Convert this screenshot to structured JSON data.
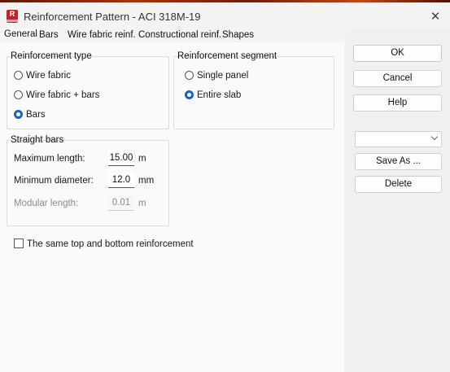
{
  "window": {
    "title": "Reinforcement Pattern - ACI 318M-19",
    "icon_name": "robot-app-icon",
    "icon_letter": "R",
    "close_glyph": "✕"
  },
  "tabs": [
    {
      "label": "General",
      "active": true
    },
    {
      "label": "Bars",
      "active": false
    },
    {
      "label": "Wire fabric reinf.",
      "active": false
    },
    {
      "label": "Constructional reinf.",
      "active": false
    },
    {
      "label": "Shapes",
      "active": false
    }
  ],
  "reinforcement_type": {
    "label": "Reinforcement type",
    "options": [
      {
        "label": "Wire fabric",
        "selected": false
      },
      {
        "label": "Wire fabric + bars",
        "selected": false
      },
      {
        "label": "Bars",
        "selected": true
      }
    ]
  },
  "reinforcement_segment": {
    "label": "Reinforcement segment",
    "options": [
      {
        "label": "Single panel",
        "selected": false
      },
      {
        "label": "Entire slab",
        "selected": true
      }
    ]
  },
  "straight_bars": {
    "label": "Straight bars",
    "fields": [
      {
        "label": "Maximum length:",
        "value": "15.00",
        "unit": "m",
        "enabled": true
      },
      {
        "label": "Minimum diameter:",
        "value": "12.0",
        "unit": "mm",
        "enabled": true
      },
      {
        "label": "Modular length:",
        "value": "0.01",
        "unit": "m",
        "enabled": false
      }
    ]
  },
  "same_reinforcement": {
    "label": "The same top and bottom reinforcement",
    "checked": false
  },
  "buttons": {
    "ok": "OK",
    "cancel": "Cancel",
    "help": "Help",
    "save_as": "Save As ...",
    "delete": "Delete"
  },
  "preset_select": {
    "value": ""
  },
  "colors": {
    "accent": "#1565c0",
    "brand": "#c8202a"
  }
}
